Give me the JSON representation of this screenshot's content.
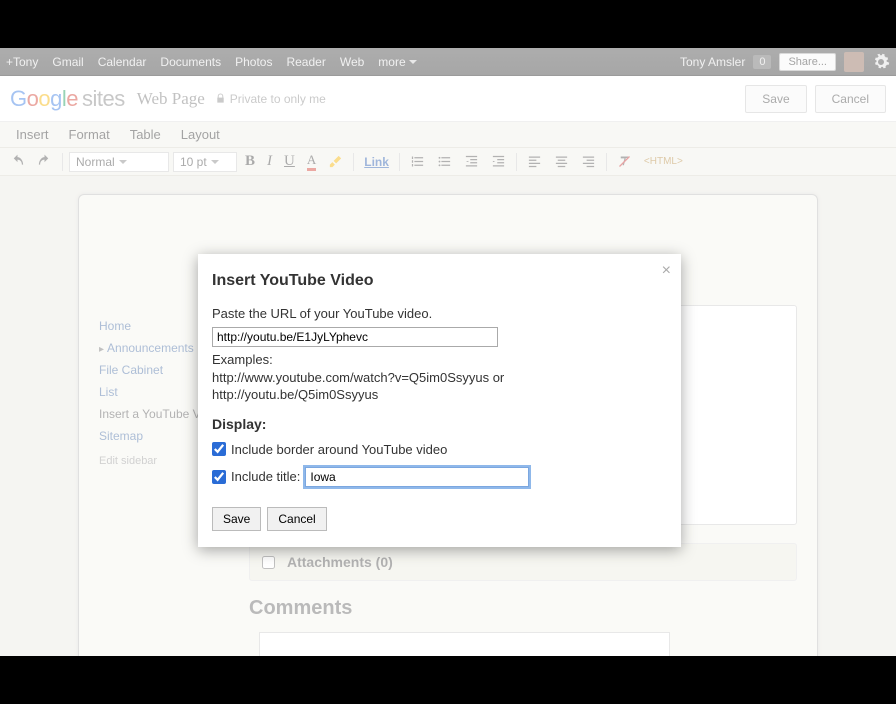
{
  "gbar": {
    "left": [
      "+Tony",
      "Gmail",
      "Calendar",
      "Documents",
      "Photos",
      "Reader",
      "Web"
    ],
    "more": "more",
    "user": "Tony Amsler",
    "count": "0",
    "share": "Share..."
  },
  "header": {
    "brand_sites": "sites",
    "pagename": "Web Page",
    "privacy": "Private to only me",
    "save": "Save",
    "cancel": "Cancel"
  },
  "menubar": [
    "Insert",
    "Format",
    "Table",
    "Layout"
  ],
  "toolbar": {
    "style": "Normal",
    "size": "10 pt",
    "link": "Link",
    "html": "HTML"
  },
  "sidebar": {
    "items": [
      {
        "label": "Home"
      },
      {
        "label": "Announcements",
        "head": true
      },
      {
        "label": "File Cabinet"
      },
      {
        "label": "List"
      },
      {
        "label": "Insert a YouTube Video",
        "sel": true
      },
      {
        "label": "Sitemap"
      }
    ],
    "edit": "Edit sidebar"
  },
  "attachments": {
    "label": "Attachments (0)"
  },
  "comments": {
    "heading": "Comments"
  },
  "modal": {
    "title": "Insert YouTube Video",
    "instruction": "Paste the URL of your YouTube video.",
    "url_value": "http://youtu.be/E1JyLYphevc",
    "examples_label": "Examples:",
    "example1": "http://www.youtube.com/watch?v=Q5im0Ssyyus or",
    "example2": "http://youtu.be/Q5im0Ssyyus",
    "display_heading": "Display:",
    "include_border_label": "Include border around YouTube video",
    "include_border_checked": true,
    "include_title_label": "Include title:",
    "include_title_checked": true,
    "title_value": "Iowa",
    "save": "Save",
    "cancel": "Cancel"
  }
}
